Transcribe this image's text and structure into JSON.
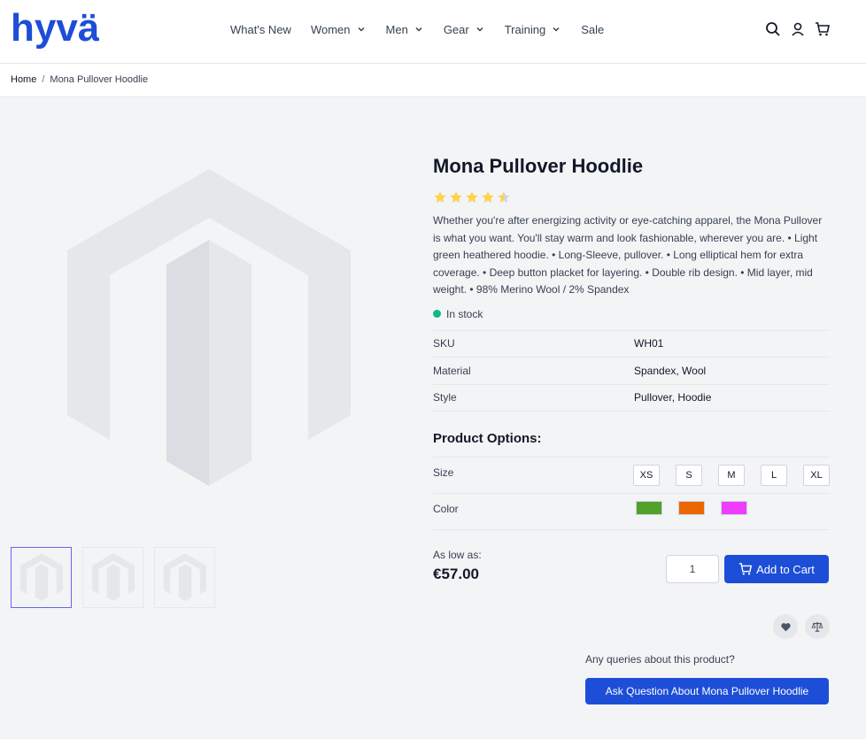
{
  "brand": {
    "logo_text": "hyvä",
    "accent": "#1d4ed8"
  },
  "nav": {
    "items": [
      {
        "label": "What's New",
        "dropdown": false
      },
      {
        "label": "Women",
        "dropdown": true
      },
      {
        "label": "Men",
        "dropdown": true
      },
      {
        "label": "Gear",
        "dropdown": true
      },
      {
        "label": "Training",
        "dropdown": true
      },
      {
        "label": "Sale",
        "dropdown": false
      }
    ]
  },
  "header_icons": [
    "search-icon",
    "user-icon",
    "cart-icon"
  ],
  "breadcrumb": {
    "home": "Home",
    "separator": "/",
    "current": "Mona Pullover Hoodlie"
  },
  "product": {
    "title": "Mona Pullover Hoodlie",
    "rating": 4.5,
    "description": "Whether you're after energizing activity or eye-catching apparel, the Mona Pullover is what you want. You'll stay warm and look fashionable, wherever you are. • Light green heathered hoodie. • Long-Sleeve, pullover. • Long elliptical hem for extra coverage. • Deep button placket for layering. • Double rib design. • Mid layer, mid weight. • 98% Merino Wool / 2% Spandex",
    "stock": "In stock",
    "attributes": [
      {
        "key": "SKU",
        "value": "WH01"
      },
      {
        "key": "Material",
        "value": "Spandex, Wool"
      },
      {
        "key": "Style",
        "value": "Pullover, Hoodie"
      }
    ],
    "options_title": "Product Options:",
    "size_label": "Size",
    "sizes": [
      "XS",
      "S",
      "M",
      "L",
      "XL"
    ],
    "color_label": "Color",
    "colors": [
      "#53a02c",
      "#eb6703",
      "#ef3dff"
    ],
    "as_low_as": "As low as:",
    "price": "€57.00",
    "qty": "1",
    "add_to_cart": "Add to Cart",
    "queries": "Any queries about this product?",
    "ask_question": "Ask Question About Mona Pullover Hoodlie"
  }
}
